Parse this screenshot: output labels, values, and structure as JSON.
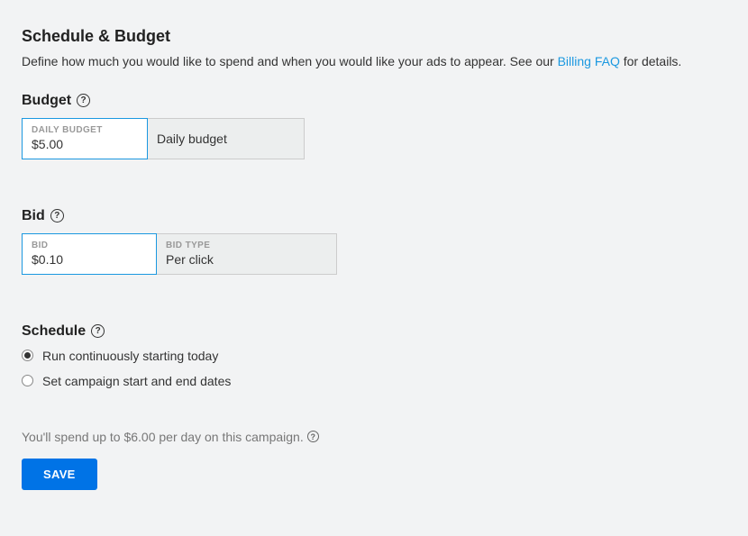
{
  "header": {
    "title": "Schedule & Budget",
    "subtitle_pre": "Define how much you would like to spend and when you would like your ads to appear. See our ",
    "link_text": "Billing FAQ",
    "subtitle_post": " for details."
  },
  "budget": {
    "heading": "Budget",
    "daily_label": "DAILY BUDGET",
    "daily_value": "$5.00",
    "type_value": "Daily budget"
  },
  "bid": {
    "heading": "Bid",
    "label": "BID",
    "value": "$0.10",
    "type_label": "BID TYPE",
    "type_value": "Per click"
  },
  "schedule": {
    "heading": "Schedule",
    "option_continuous": "Run continuously starting today",
    "option_set_dates": "Set campaign start and end dates"
  },
  "summary": {
    "text": "You'll spend up to $6.00 per day on this campaign."
  },
  "actions": {
    "save_label": "SAVE"
  }
}
